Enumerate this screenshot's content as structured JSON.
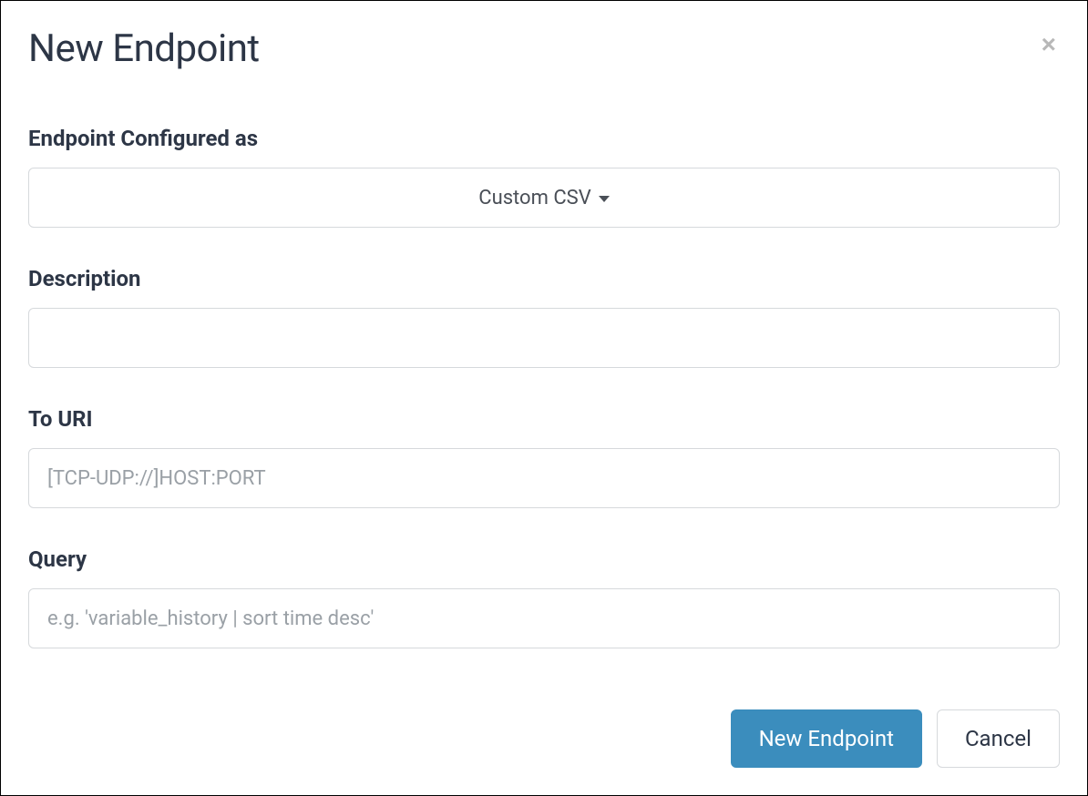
{
  "modal": {
    "title": "New Endpoint",
    "close_icon": "×"
  },
  "form": {
    "configured_as": {
      "label": "Endpoint Configured as",
      "selected": "Custom CSV"
    },
    "description": {
      "label": "Description",
      "value": "",
      "placeholder": ""
    },
    "to_uri": {
      "label": "To URI",
      "value": "",
      "placeholder": "[TCP-UDP://]HOST:PORT"
    },
    "query": {
      "label": "Query",
      "value": "",
      "placeholder": "e.g. 'variable_history | sort time desc'"
    }
  },
  "footer": {
    "submit_label": "New Endpoint",
    "cancel_label": "Cancel"
  }
}
